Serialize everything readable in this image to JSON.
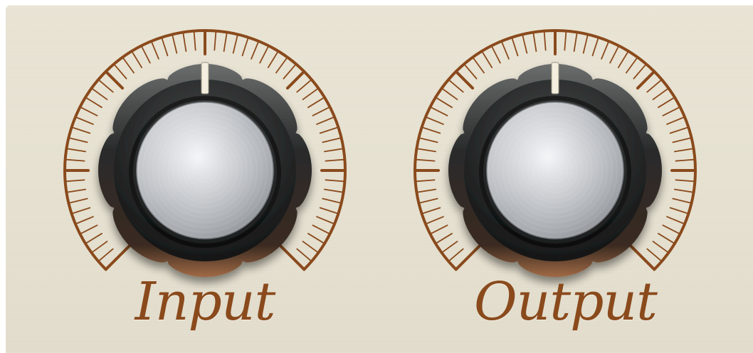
{
  "knobs": [
    {
      "id": "input",
      "label": "Input",
      "value": 0.5
    },
    {
      "id": "output",
      "label": "Output",
      "value": 0.5
    }
  ],
  "colors": {
    "panel": "#e6e1d0",
    "scale": "#8a4a1c",
    "knob_body": "#2a2b2b",
    "cap": "#c9ccd0",
    "indicator": "#f4eedf"
  }
}
